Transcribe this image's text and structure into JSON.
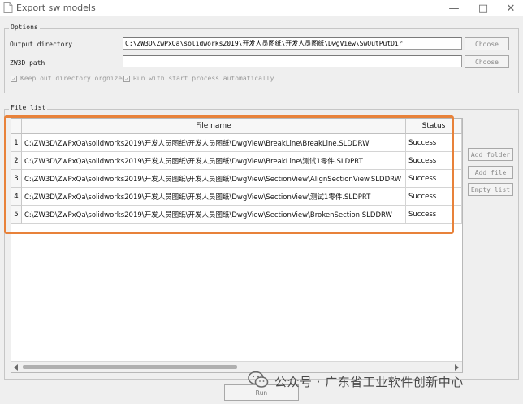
{
  "window": {
    "title": "Export sw models",
    "minimize": "—",
    "maximize": "□",
    "close": "✕"
  },
  "options": {
    "group_title": "Options",
    "output_directory": {
      "label": "Output directory",
      "value": "C:\\ZW3D\\ZwPxQa\\solidworks2019\\开发人员图纸\\开发人员图纸\\DwgView\\SwOutPutDir",
      "button": "Choose"
    },
    "zw3d_path": {
      "label": "ZW3D path",
      "value": "",
      "button": "Choose"
    },
    "keep_dir_checkbox": {
      "label": "Keep out directory orgnized",
      "checked": true
    },
    "auto_run_checkbox": {
      "label": "Run with start process automatically",
      "checked": true
    }
  },
  "file_list": {
    "group_title": "File list",
    "columns": [
      "File name",
      "Status"
    ],
    "rows": [
      {
        "index": "1",
        "file": "C:\\ZW3D\\ZwPxQa\\solidworks2019\\开发人员图纸\\开发人员图纸\\DwgView\\BreakLine\\BreakLine.SLDDRW",
        "status": "Success"
      },
      {
        "index": "2",
        "file": "C:\\ZW3D\\ZwPxQa\\solidworks2019\\开发人员图纸\\开发人员图纸\\DwgView\\BreakLine\\测试1零件.SLDPRT",
        "status": "Success"
      },
      {
        "index": "3",
        "file": "C:\\ZW3D\\ZwPxQa\\solidworks2019\\开发人员图纸\\开发人员图纸\\DwgView\\SectionView\\AlignSectionView.SLDDRW",
        "status": "Success"
      },
      {
        "index": "4",
        "file": "C:\\ZW3D\\ZwPxQa\\solidworks2019\\开发人员图纸\\开发人员图纸\\DwgView\\SectionView\\测试1零件.SLDPRT",
        "status": "Success"
      },
      {
        "index": "5",
        "file": "C:\\ZW3D\\ZwPxQa\\solidworks2019\\开发人员图纸\\开发人员图纸\\DwgView\\SectionView\\BrokenSection.SLDDRW",
        "status": "Success"
      }
    ],
    "buttons": {
      "add_folder": "Add folder",
      "add_file": "Add file",
      "empty_list": "Empty list"
    }
  },
  "run_button": "Run",
  "watermark": "公众号 · 广东省工业软件创新中心",
  "colors": {
    "highlight": "#e8823a",
    "background": "#efefef"
  }
}
